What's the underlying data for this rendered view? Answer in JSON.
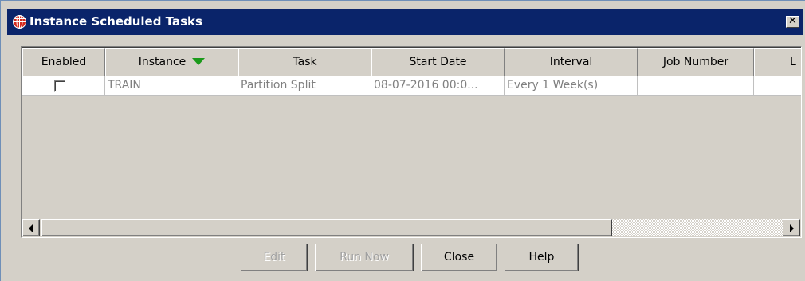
{
  "window": {
    "title": "Instance Scheduled Tasks",
    "close_glyph": "✕",
    "icon": "globe-icon"
  },
  "table": {
    "columns": [
      {
        "label": "Enabled"
      },
      {
        "label": "Instance",
        "sorted": "descending"
      },
      {
        "label": "Task"
      },
      {
        "label": "Start Date"
      },
      {
        "label": "Interval"
      },
      {
        "label": "Job Number"
      },
      {
        "label": "L"
      }
    ],
    "rows": [
      {
        "enabled": false,
        "instance": "TRAIN",
        "task": "Partition Split",
        "start_date": "08-07-2016 00:0...",
        "interval": "Every 1 Week(s)",
        "job_number": "",
        "last": ""
      }
    ]
  },
  "buttons": {
    "edit": {
      "label": "Edit",
      "enabled": false
    },
    "run_now": {
      "label": "Run Now",
      "enabled": false
    },
    "close": {
      "label": "Close",
      "enabled": true
    },
    "help": {
      "label": "Help",
      "enabled": true
    }
  },
  "colors": {
    "titlebar": "#0a246a",
    "face": "#d4d0c8",
    "sort_arrow": "#1a9a1a"
  }
}
